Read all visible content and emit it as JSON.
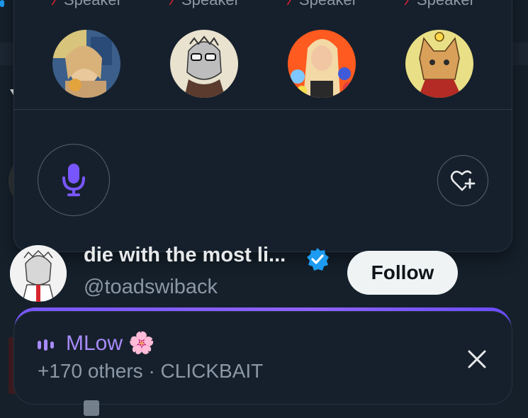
{
  "speakers": [
    {
      "role": "Speaker",
      "muted": true,
      "avatar_colors": [
        "#3b5f8a",
        "#e9c89b"
      ]
    },
    {
      "role": "Speaker",
      "muted": true,
      "avatar_colors": [
        "#e8e2cf",
        "#6b6b6b"
      ]
    },
    {
      "role": "Speaker",
      "muted": true,
      "avatar_colors": [
        "#ff5a1f",
        "#f1d7b3"
      ]
    },
    {
      "role": "Speaker",
      "muted": true,
      "avatar_colors": [
        "#e9df86",
        "#c98b4a"
      ]
    }
  ],
  "controls": {
    "mic_icon": "microphone-icon",
    "react_icon": "heart-plus-icon"
  },
  "profile": {
    "name": "die with the most li...",
    "handle": "@toadswiback",
    "follow_label": "Follow"
  },
  "dock": {
    "title": "MLow 🌸",
    "subtitle": "+170 others · CLICKBAIT",
    "close_icon": "close-icon"
  },
  "colors": {
    "accent": "#a78bfa",
    "mic": "#7856ff",
    "background": "#15202b",
    "muted_red": "#f4212e",
    "verified_blue": "#1d9bf0"
  }
}
